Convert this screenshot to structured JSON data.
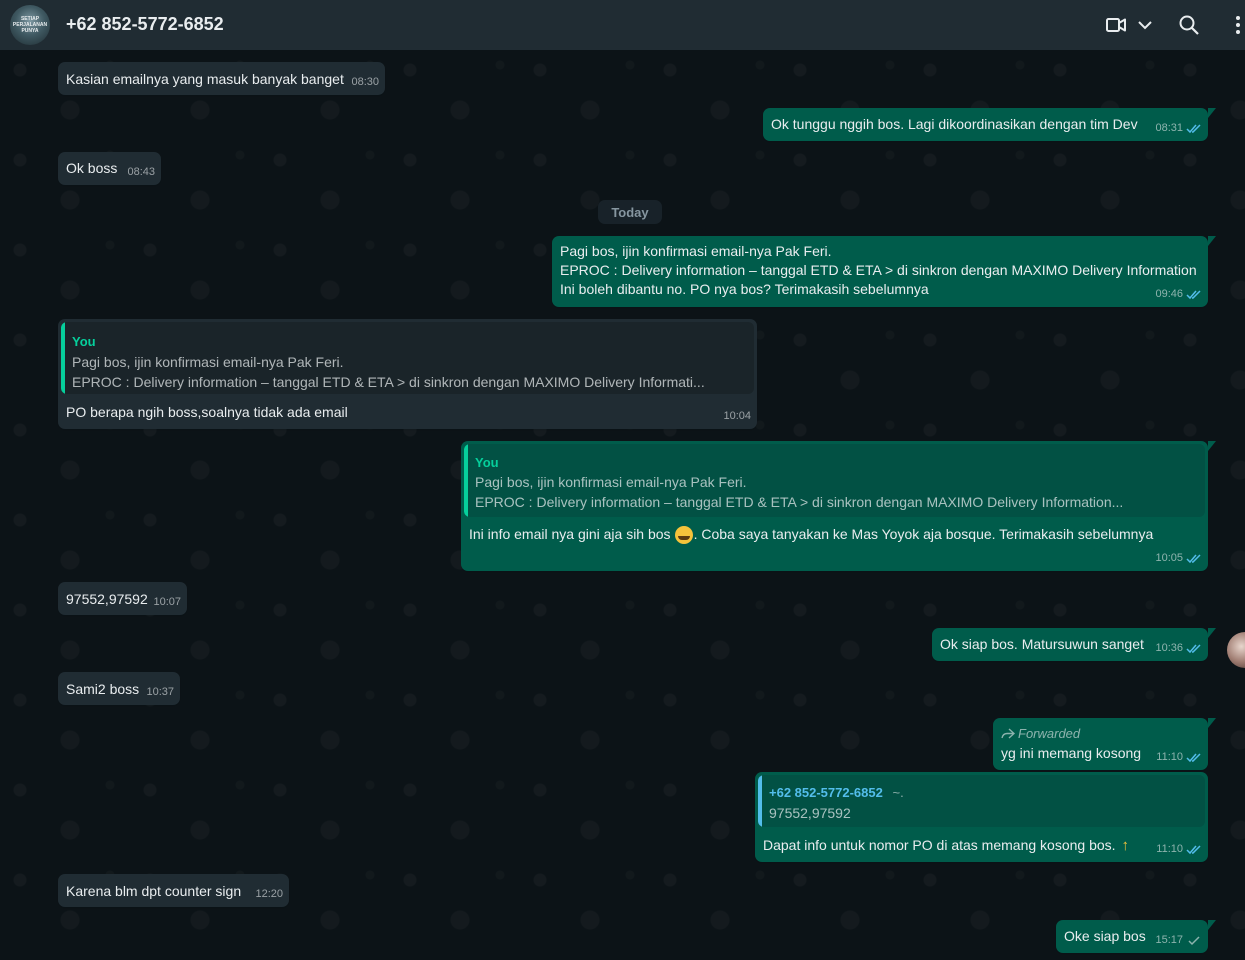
{
  "header": {
    "contact_name": "+62 852-5772-6852",
    "avatar_text": "SETIAP PERJALANAN PUNYA"
  },
  "date_separator": "Today",
  "colors": {
    "incoming_bubble": "#202c33",
    "outgoing_bubble": "#005c4b",
    "read_tick": "#53bdeb",
    "quote_you": "#06cf9c",
    "quote_contact": "#53bdeb"
  },
  "messages": [
    {
      "direction": "in",
      "text": "Kasian emailnya yang masuk banyak banget",
      "time": "08:30"
    },
    {
      "direction": "out",
      "text": "Ok tunggu nggih bos. Lagi dikoordinasikan dengan tim Dev",
      "time": "08:31",
      "status": "read"
    },
    {
      "direction": "in",
      "text": "Ok boss",
      "time": "08:43"
    },
    {
      "direction": "out",
      "lines": [
        "Pagi bos, ijin konfirmasi email-nya Pak Feri.",
        "EPROC : Delivery information – tanggal ETD & ETA  > di sinkron dengan MAXIMO Delivery Information",
        "Ini boleh dibantu no. PO nya bos? Terimakasih sebelumnya"
      ],
      "time": "09:46",
      "status": "read"
    },
    {
      "direction": "in",
      "quote": {
        "author": "You",
        "line1": "Pagi bos, ijin konfirmasi email-nya Pak Feri.",
        "line2": "EPROC : Delivery information – tanggal ETD & ETA  > di sinkron dengan MAXIMO Delivery Informati..."
      },
      "text": "PO berapa ngih boss,soalnya tidak ada email",
      "time": "10:04"
    },
    {
      "direction": "out",
      "quote": {
        "author": "You",
        "line1": "Pagi bos, ijin konfirmasi email-nya Pak Feri.",
        "line2": "EPROC : Delivery information – tanggal ETD & ETA  > di sinkron dengan MAXIMO Delivery Information..."
      },
      "text_before": "Ini info email nya gini aja sih bos",
      "text_after": ". Coba saya tanyakan ke Mas Yoyok aja bosque. Terimakasih sebelumnya",
      "time": "10:05",
      "status": "read"
    },
    {
      "direction": "in",
      "text": "97552,97592",
      "time": "10:07"
    },
    {
      "direction": "out",
      "text": "Ok siap bos. Matursuwun sanget",
      "time": "10:36",
      "status": "read"
    },
    {
      "direction": "in",
      "text": "Sami2 boss",
      "time": "10:37"
    },
    {
      "direction": "out",
      "forwarded": "Forwarded",
      "text": "yg ini memang kosong",
      "time": "11:10",
      "status": "read"
    },
    {
      "direction": "out",
      "quote": {
        "author": "+62 852-5772-6852",
        "author_suffix": "~.",
        "line1": "97552,97592"
      },
      "text": "Dapat info untuk nomor PO di atas memang kosong bos.",
      "time": "11:10",
      "status": "read"
    },
    {
      "direction": "in",
      "text": "Karena blm dpt counter sign",
      "time": "12:20"
    },
    {
      "direction": "out",
      "text": "Oke siap bos",
      "time": "15:17",
      "status": "sent"
    }
  ]
}
